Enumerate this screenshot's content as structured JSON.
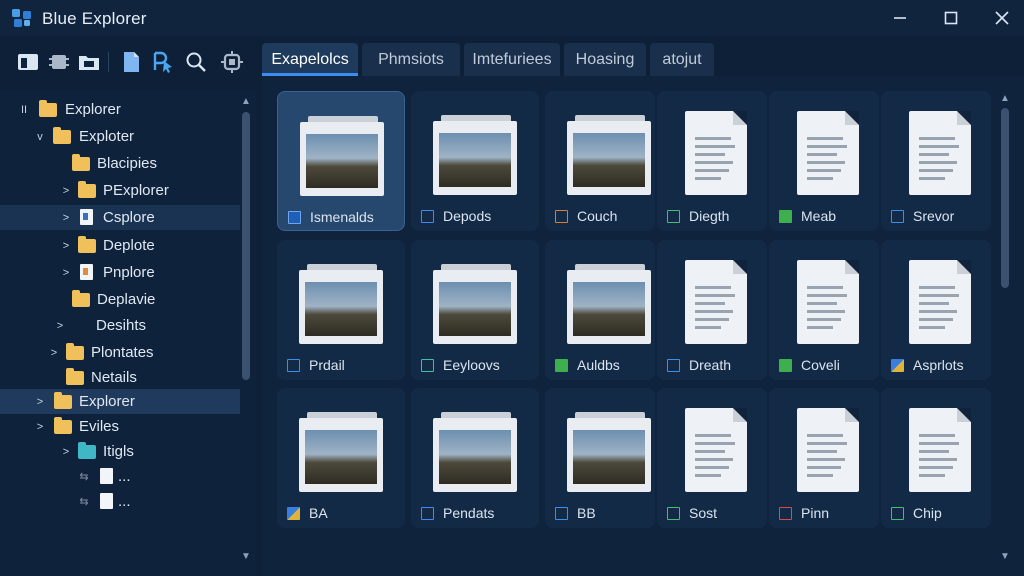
{
  "window": {
    "title": "Blue Explorer"
  },
  "toolbar": {
    "tools": [
      "panel-icon",
      "chip-icon",
      "folder-tool-icon",
      "new-file-icon",
      "cursor-icon",
      "search-icon",
      "settings-icon"
    ]
  },
  "tabs": [
    {
      "label": "Exapelolcs",
      "active": true
    },
    {
      "label": "Phmsiots",
      "active": false
    },
    {
      "label": "Imtefuriees",
      "active": false
    },
    {
      "label": "Hoasing",
      "active": false
    },
    {
      "label": "atojut",
      "active": false
    }
  ],
  "sidebar": {
    "items": [
      {
        "label": "Explorer",
        "icon": "folder",
        "caret": "II"
      },
      {
        "label": "Exploter",
        "icon": "folder",
        "caret": "v"
      },
      {
        "label": "Blacipies",
        "icon": "folder",
        "caret": ""
      },
      {
        "label": "PExplorer",
        "icon": "folder",
        "caret": ">"
      },
      {
        "label": "Csplore",
        "icon": "doc-blue",
        "caret": ">"
      },
      {
        "label": "Deplote",
        "icon": "folder",
        "caret": ">"
      },
      {
        "label": "Pnplore",
        "icon": "doc-orange",
        "caret": ">"
      },
      {
        "label": "Deplavie",
        "icon": "folder",
        "caret": ""
      },
      {
        "label": "Desihts",
        "icon": "",
        "caret": ">"
      },
      {
        "label": "Plontates",
        "icon": "folder",
        "caret": ">"
      },
      {
        "label": "Netails",
        "icon": "folder",
        "caret": ""
      },
      {
        "label": "Explorer",
        "icon": "folder",
        "caret": ">"
      },
      {
        "label": "Eviles",
        "icon": "folder",
        "caret": ">"
      },
      {
        "label": "Itigls",
        "icon": "folder-teal",
        "caret": ">"
      },
      {
        "label": "...",
        "icon": "doc",
        "caret": ""
      },
      {
        "label": "...",
        "icon": "doc",
        "caret": ""
      }
    ]
  },
  "files": [
    {
      "label": "Ismenalds",
      "thumb": "photo",
      "label_icon": "check",
      "selected": true
    },
    {
      "label": "Depods",
      "thumb": "photo",
      "label_icon": "blue"
    },
    {
      "label": "Couch",
      "thumb": "photo",
      "label_icon": "orange"
    },
    {
      "label": "Diegth",
      "thumb": "doc",
      "label_icon": "green"
    },
    {
      "label": "Meab",
      "thumb": "doc",
      "label_icon": "fgreen"
    },
    {
      "label": "Srevor",
      "thumb": "doc",
      "label_icon": "blue"
    },
    {
      "label": "Prdail",
      "thumb": "photo",
      "label_icon": "blue"
    },
    {
      "label": "Eeyloovs",
      "thumb": "photo",
      "label_icon": "teal"
    },
    {
      "label": "Auldbs",
      "thumb": "photo",
      "label_icon": "fgreen"
    },
    {
      "label": "Dreath",
      "thumb": "doc",
      "label_icon": "blue"
    },
    {
      "label": "Coveli",
      "thumb": "doc",
      "label_icon": "fgreen"
    },
    {
      "label": "Asprlots",
      "thumb": "doc",
      "label_icon": "img"
    },
    {
      "label": "BA",
      "thumb": "photo",
      "label_icon": "img"
    },
    {
      "label": "Pendats",
      "thumb": "photo",
      "label_icon": "blue"
    },
    {
      "label": "BB",
      "thumb": "photo",
      "label_icon": "blue"
    },
    {
      "label": "Sost",
      "thumb": "doc",
      "label_icon": "green"
    },
    {
      "label": "Pinn",
      "thumb": "doc",
      "label_icon": "red"
    },
    {
      "label": "Chip",
      "thumb": "doc",
      "label_icon": "green"
    }
  ],
  "colors": {
    "accent": "#3d8df0",
    "folder": "#f0c05a",
    "background": "#0e2038"
  }
}
